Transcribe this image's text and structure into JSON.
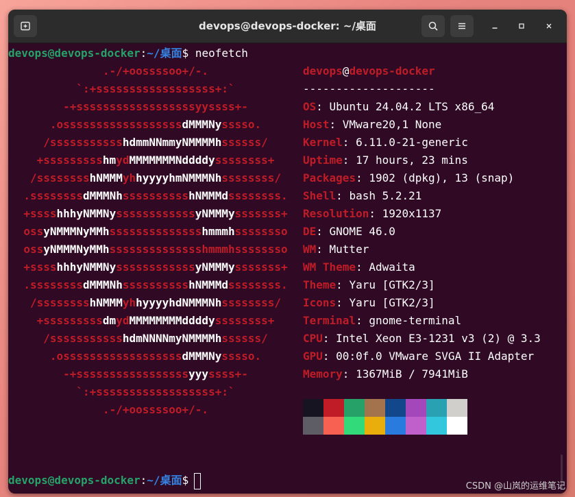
{
  "window": {
    "title": "devops@devops-docker: ~/桌面"
  },
  "icons": {
    "new_tab": "new-tab-icon",
    "search": "search-icon",
    "menu": "hamburger-menu-icon",
    "minimize": "minimize-icon",
    "maximize": "maximize-icon",
    "close": "close-icon"
  },
  "terminal": {
    "prompt_user": "devops@devops-docker",
    "prompt_colon": ":",
    "prompt_path": "~/桌面",
    "prompt_symbol": "$",
    "command": "neofetch",
    "logo": [
      [
        {
          "t": ".-/+oossssoo+/-.",
          "c": "r"
        }
      ],
      [
        {
          "t": "`:+ssssssssssssssssss+:`",
          "c": "r"
        }
      ],
      [
        {
          "t": "-+ssssssssssssssssssyyssss+-",
          "c": "r"
        }
      ],
      [
        {
          "t": ".ossssssssssssssssss",
          "c": "r"
        },
        {
          "t": "dMMMNy",
          "c": "w"
        },
        {
          "t": "sssso.",
          "c": "r"
        }
      ],
      [
        {
          "t": "/sssssssssss",
          "c": "r"
        },
        {
          "t": "hdmmNNmmyNMMMMh",
          "c": "w"
        },
        {
          "t": "ssssss/",
          "c": "r"
        }
      ],
      [
        {
          "t": "+sssssssss",
          "c": "r"
        },
        {
          "t": "hm",
          "c": "w"
        },
        {
          "t": "yd",
          "c": "r"
        },
        {
          "t": "MMMMMMMNddddy",
          "c": "w"
        },
        {
          "t": "ssssssss+",
          "c": "r"
        }
      ],
      [
        {
          "t": "/ssssssss",
          "c": "r"
        },
        {
          "t": "hNMMM",
          "c": "w"
        },
        {
          "t": "yh",
          "c": "r"
        },
        {
          "t": "hyyyyhmNMMMNh",
          "c": "w"
        },
        {
          "t": "ssssssss/",
          "c": "r"
        }
      ],
      [
        {
          "t": ".ssssssss",
          "c": "r"
        },
        {
          "t": "dMMMNh",
          "c": "w"
        },
        {
          "t": "ssssssssss",
          "c": "r"
        },
        {
          "t": "hNMMMd",
          "c": "w"
        },
        {
          "t": "ssssssss.",
          "c": "r"
        }
      ],
      [
        {
          "t": "+ssss",
          "c": "r"
        },
        {
          "t": "hhhyNMMNy",
          "c": "w"
        },
        {
          "t": "ssssssssssss",
          "c": "r"
        },
        {
          "t": "yNMMMy",
          "c": "w"
        },
        {
          "t": "sssssss+",
          "c": "r"
        }
      ],
      [
        {
          "t": "oss",
          "c": "r"
        },
        {
          "t": "yNMMMNyMMh",
          "c": "w"
        },
        {
          "t": "ssssssssssssss",
          "c": "r"
        },
        {
          "t": "hmmmh",
          "c": "w"
        },
        {
          "t": "ssssssso",
          "c": "r"
        }
      ],
      [
        {
          "t": "oss",
          "c": "r"
        },
        {
          "t": "yNMMMNyMMh",
          "c": "w"
        },
        {
          "t": "sssssssssssssshmmmhssssssso",
          "c": "r"
        }
      ],
      [
        {
          "t": "+ssss",
          "c": "r"
        },
        {
          "t": "hhhyNMMNy",
          "c": "w"
        },
        {
          "t": "ssssssssssss",
          "c": "r"
        },
        {
          "t": "yNMMMy",
          "c": "w"
        },
        {
          "t": "sssssss+",
          "c": "r"
        }
      ],
      [
        {
          "t": ".ssssssss",
          "c": "r"
        },
        {
          "t": "dMMMNh",
          "c": "w"
        },
        {
          "t": "ssssssssss",
          "c": "r"
        },
        {
          "t": "hNMMMd",
          "c": "w"
        },
        {
          "t": "ssssssss.",
          "c": "r"
        }
      ],
      [
        {
          "t": "/ssssssss",
          "c": "r"
        },
        {
          "t": "hNMMM",
          "c": "w"
        },
        {
          "t": "yh",
          "c": "r"
        },
        {
          "t": "hyyyyhdNMMMNh",
          "c": "w"
        },
        {
          "t": "ssssssss/",
          "c": "r"
        }
      ],
      [
        {
          "t": "+sssssssss",
          "c": "r"
        },
        {
          "t": "dm",
          "c": "w"
        },
        {
          "t": "yd",
          "c": "r"
        },
        {
          "t": "MMMMMMMMddddy",
          "c": "w"
        },
        {
          "t": "ssssssss+",
          "c": "r"
        }
      ],
      [
        {
          "t": "/sssssssssss",
          "c": "r"
        },
        {
          "t": "hdmNNNNmyNMMMMh",
          "c": "w"
        },
        {
          "t": "ssssss/",
          "c": "r"
        }
      ],
      [
        {
          "t": ".ossssssssssssssssss",
          "c": "r"
        },
        {
          "t": "dMMMNy",
          "c": "w"
        },
        {
          "t": "sssso.",
          "c": "r"
        }
      ],
      [
        {
          "t": "-+sssssssssssssssss",
          "c": "r"
        },
        {
          "t": "yyy",
          "c": "w"
        },
        {
          "t": "ssss+-",
          "c": "r"
        }
      ],
      [
        {
          "t": "`:+ssssssssssssssssss+:`",
          "c": "r"
        }
      ],
      [
        {
          "t": ".-/+oossssoo+/-.",
          "c": "r"
        }
      ]
    ],
    "info_header": {
      "user": "devops",
      "at": "@",
      "host": "devops-docker",
      "separator": "--------------------"
    },
    "info": [
      {
        "key": "OS",
        "value": "Ubuntu 24.04.2 LTS x86_64"
      },
      {
        "key": "Host",
        "value": "VMware20,1 None"
      },
      {
        "key": "Kernel",
        "value": "6.11.0-21-generic"
      },
      {
        "key": "Uptime",
        "value": "17 hours, 23 mins"
      },
      {
        "key": "Packages",
        "value": "1902 (dpkg), 13 (snap)"
      },
      {
        "key": "Shell",
        "value": "bash 5.2.21"
      },
      {
        "key": "Resolution",
        "value": "1920x1137"
      },
      {
        "key": "DE",
        "value": "GNOME 46.0"
      },
      {
        "key": "WM",
        "value": "Mutter"
      },
      {
        "key": "WM Theme",
        "value": "Adwaita"
      },
      {
        "key": "Theme",
        "value": "Yaru [GTK2/3]"
      },
      {
        "key": "Icons",
        "value": "Yaru [GTK2/3]"
      },
      {
        "key": "Terminal",
        "value": "gnome-terminal"
      },
      {
        "key": "CPU",
        "value": "Intel Xeon E3-1231 v3 (2) @ 3.3"
      },
      {
        "key": "GPU",
        "value": "00:0f.0 VMware SVGA II Adapter"
      },
      {
        "key": "Memory",
        "value": "1367MiB / 7941MiB"
      }
    ],
    "palette_top": [
      "#171421",
      "#c01c28",
      "#26a269",
      "#a2734c",
      "#12488b",
      "#a347ba",
      "#2aa1b3",
      "#d0cfcc"
    ],
    "palette_bottom": [
      "#5e5c64",
      "#f66151",
      "#33da7a",
      "#e9ad0c",
      "#2a7bde",
      "#c061cb",
      "#33c7de",
      "#ffffff"
    ]
  },
  "colors": {
    "terminal_bg": "#300a24",
    "ubuntu_red": "#c01c28",
    "prompt_green": "#26a269",
    "prompt_blue": "#3584e4"
  },
  "watermark": "CSDN @山岚的运维笔记"
}
